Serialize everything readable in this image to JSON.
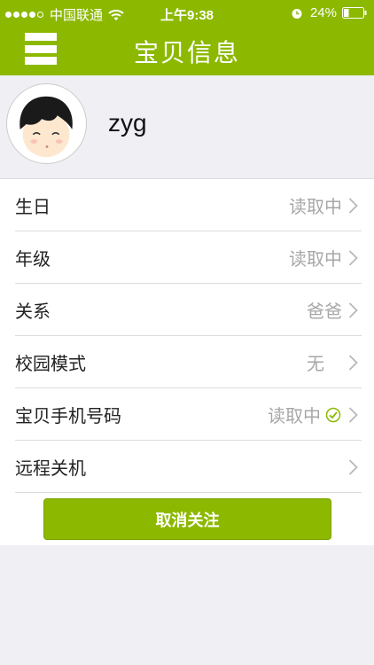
{
  "status_bar": {
    "carrier": "中国联通",
    "time": "上午9:38",
    "battery": "24%",
    "signal_icon": "signal-dots-icon",
    "wifi_icon": "wifi-icon",
    "alarm_icon": "alarm-clock-icon",
    "battery_icon": "battery-icon"
  },
  "nav": {
    "title": "宝贝信息",
    "menu_icon": "menu-icon"
  },
  "profile": {
    "name": "zyg",
    "avatar_icon": "cartoon-boy-avatar"
  },
  "rows": [
    {
      "label": "生日",
      "value": "读取中"
    },
    {
      "label": "年级",
      "value": "读取中"
    },
    {
      "label": "关系",
      "value": "爸爸"
    },
    {
      "label": "校园模式",
      "value": "无"
    },
    {
      "label": "宝贝手机号码",
      "value": "读取中",
      "check_icon": "check-circle-icon"
    },
    {
      "label": "远程关机",
      "value": ""
    }
  ],
  "actions": {
    "cancel_follow": "取消关注"
  },
  "colors": {
    "accent": "#8cb900",
    "background": "#efeff4",
    "value_text": "#a7a7a7"
  }
}
